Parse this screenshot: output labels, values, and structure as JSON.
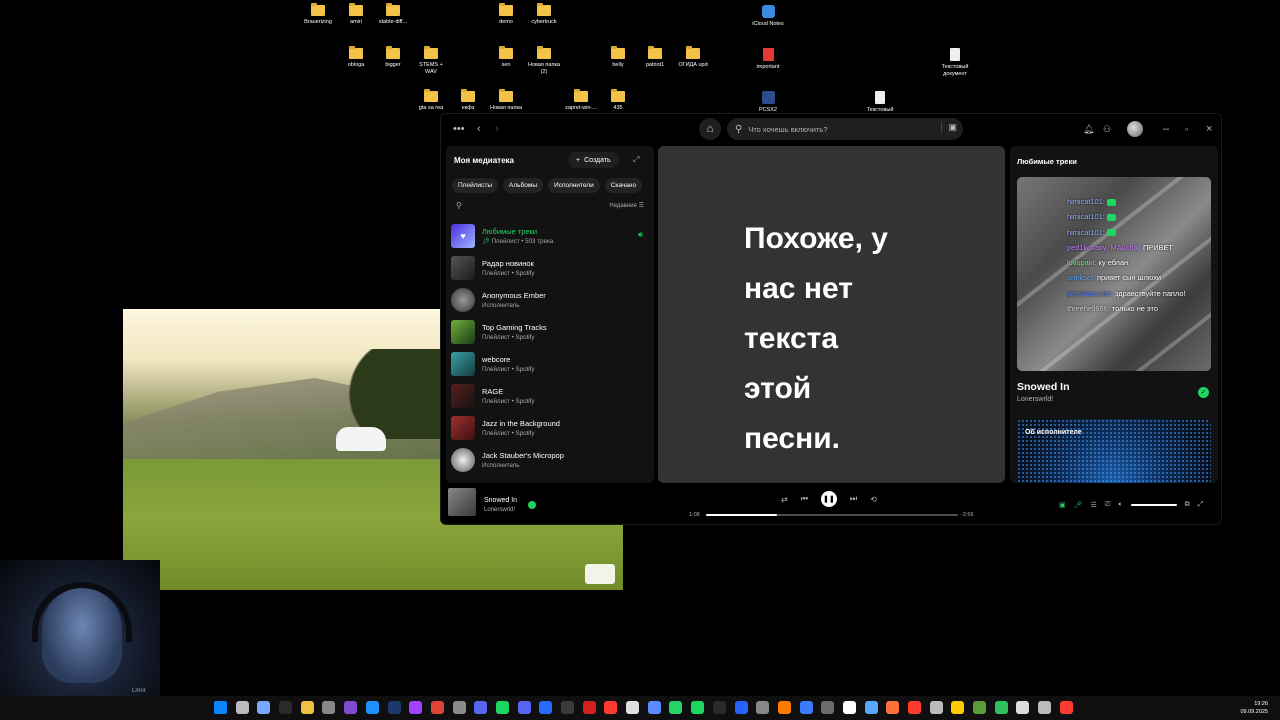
{
  "desktop": {
    "icons": [
      {
        "label": "Brauerizing",
        "type": "folder"
      },
      {
        "label": "amiri",
        "type": "folder"
      },
      {
        "label": "stable-diff...",
        "type": "folder"
      },
      {
        "label": "demo",
        "type": "folder"
      },
      {
        "label": "cybertruck",
        "type": "folder"
      },
      {
        "label": "iCloud Notes",
        "type": "blue"
      },
      {
        "label": "obloga",
        "type": "folder"
      },
      {
        "label": "bigger",
        "type": "folder"
      },
      {
        "label": "STEMS +\nWAV",
        "type": "folder"
      },
      {
        "label": "sen",
        "type": "folder"
      },
      {
        "label": "Новая папка\n(2)",
        "type": "folder"
      },
      {
        "label": "belly",
        "type": "folder"
      },
      {
        "label": "patriot1",
        "type": "folder"
      },
      {
        "label": "ОГИДА upd",
        "type": "folder"
      },
      {
        "label": "important",
        "type": "red"
      },
      {
        "label": "Текстовый\nдокумент",
        "type": "doc"
      },
      {
        "label": "gta sa rea",
        "type": "folder"
      },
      {
        "label": "екфз",
        "type": "folder"
      },
      {
        "label": "Новая папка",
        "type": "folder"
      },
      {
        "label": "zapret-win-...",
        "type": "folder"
      },
      {
        "label": "435",
        "type": "folder"
      },
      {
        "label": "PCSX2",
        "type": "dark"
      },
      {
        "label": "Текстовый",
        "type": "doc"
      }
    ]
  },
  "webcam": {
    "caption": "Lmnr"
  },
  "spotify": {
    "search_placeholder": "Что хочешь включить?",
    "library": {
      "title": "Моя медиатека",
      "create_label": "Создать",
      "chips": [
        "Плейлисты",
        "Альбомы",
        "Исполнители",
        "Скачано"
      ],
      "sort_label": "Недавние",
      "items": [
        {
          "name": "Любимые треки",
          "sub": "Плейлист • 503 трека",
          "active": true,
          "cover": "#5b3ee6"
        },
        {
          "name": "Радар новинок",
          "sub": "Плейлист • Spotify",
          "cover": "#3a3a3a"
        },
        {
          "name": "Anonymous Ember",
          "sub": "Исполнитель",
          "cover": "#6b6b6b"
        },
        {
          "name": "Top Gaming Tracks",
          "sub": "Плейлист • Spotify",
          "cover": "#2f6b3a"
        },
        {
          "name": "webcore",
          "sub": "Плейлист • Spotify",
          "cover": "#2f6a6f"
        },
        {
          "name": "RAGE",
          "sub": "Плейлист • Spotify",
          "cover": "#4a2020"
        },
        {
          "name": "Jazz in the Background",
          "sub": "Плейлист • Spotify",
          "cover": "#7a2626"
        },
        {
          "name": "Jack Stauber's Micropop",
          "sub": "Исполнитель",
          "cover": "#d8d8d8"
        }
      ]
    },
    "lyrics_message": "Похоже, у\nнас нет\nтекста\nэтой\nпесни.",
    "right_panel": {
      "title": "Любимые треки",
      "song": "Snowed In",
      "artist": "Lonerswrld!",
      "about_label": "Об исполнителе",
      "chat": [
        {
          "nick": "himicat101:",
          "text": "",
          "color": "#8fb0ff",
          "badge": true
        },
        {
          "nick": "himicat101:",
          "text": "",
          "color": "#8fb0ff",
          "badge": true
        },
        {
          "nick": "himicat101:",
          "text": "",
          "color": "#8fb0ff",
          "badge": true
        },
        {
          "nick": "ped1kovatiy_MALchik:",
          "text": "ПРИВЕТ",
          "color": "#c77dff"
        },
        {
          "nick": "luvupain:",
          "text": "ку еблан",
          "color": "#5dff6a"
        },
        {
          "nick": "oneksef:",
          "text": "привет сын шлюхи",
          "color": "#5aa7ff"
        },
        {
          "nick": "plombavzube:",
          "text": "здравствуйте папло!",
          "color": "#4f74ff"
        },
        {
          "nick": "threehell666:",
          "text": "только не это",
          "color": "#d0d0d0"
        }
      ]
    },
    "player": {
      "title": "Snowed In",
      "artist": "Lonerswrld!",
      "elapsed": "1:08",
      "remaining": "-2:56",
      "progress": 0.28
    }
  },
  "taskbar": {
    "time": "19:26",
    "date": "09.09.2025",
    "apps": [
      "#0a84ff",
      "#bbbbbb",
      "#7aa7ff",
      "#2a2a2a",
      "#f0c040",
      "#888888",
      "#7e4bd0",
      "#1e90ff",
      "#1b3a6b",
      "#a144ff",
      "#db4437",
      "#8b8b8b",
      "#5865f2",
      "#1ed760",
      "#5865f2",
      "#2a6bff",
      "#3a3a3a",
      "#d02020",
      "#ff3b30",
      "#e0e0e0",
      "#5a8cff",
      "#25d366",
      "#1ed760",
      "#2a2a2a",
      "#2962ff",
      "#888888",
      "#ff7a00",
      "#3b7bff",
      "#6b6b6b",
      "#ffffff",
      "#5aa7ff",
      "#ff7139",
      "#ff3b30",
      "#bbbbbb",
      "#ffcc00",
      "#5a9c3a",
      "#30c060",
      "#dddddd",
      "#bbbbbb",
      "#ff3b30"
    ]
  }
}
